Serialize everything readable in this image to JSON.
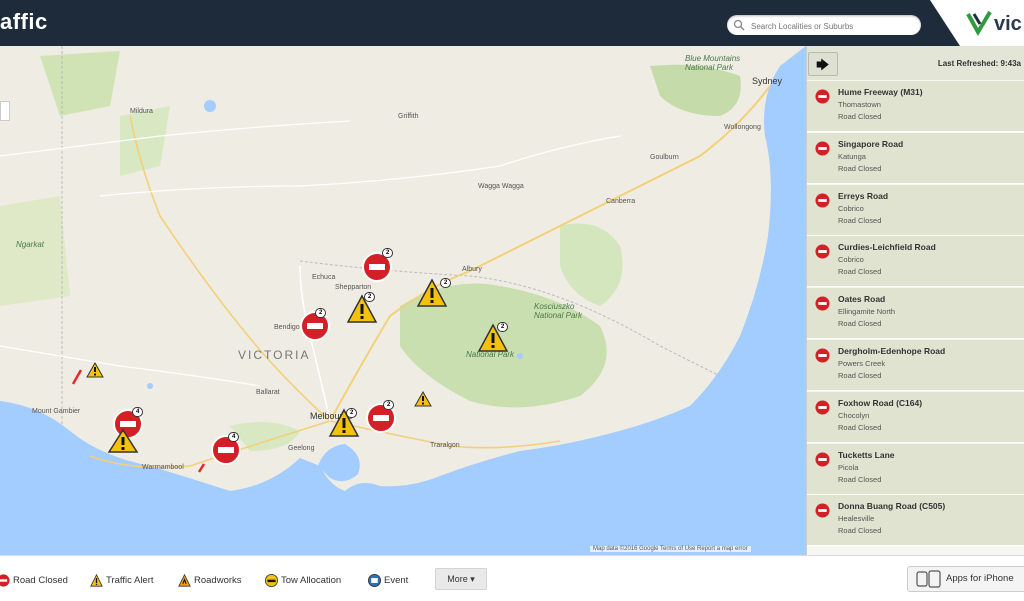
{
  "header": {
    "title": "affic",
    "search_placeholder": "Search Localities or Suburbs",
    "logo_text": "vic"
  },
  "map": {
    "region_label": "VICTORIA",
    "attribution": "Map data ©2016 Google   Terms of Use   Report a map error",
    "cities": [
      "Sydney",
      "Wollongong",
      "Canberra",
      "Goulburn",
      "Griffith",
      "Wagga Wagga",
      "Albury",
      "Echuca",
      "Shepparton",
      "Bendigo",
      "Ballarat",
      "Melbourne",
      "Geelong",
      "Traralgon",
      "Warrnambool",
      "Mount Gambier",
      "Mildura",
      "Ngarkat"
    ],
    "parks": [
      "Blue Mountains National Park",
      "Kosciuszko National Park",
      "National Park"
    ],
    "markers": [
      {
        "type": "closed",
        "count": "2"
      },
      {
        "type": "alert",
        "count": "2"
      },
      {
        "type": "closed",
        "count": "2"
      },
      {
        "type": "alert",
        "count": "2"
      },
      {
        "type": "alert",
        "count": "2"
      },
      {
        "type": "closed",
        "count": "4"
      },
      {
        "type": "closed",
        "count": "4"
      },
      {
        "type": "alert",
        "count": "2"
      },
      {
        "type": "closed",
        "count": "2"
      },
      {
        "type": "alert",
        "count": ""
      },
      {
        "type": "alert",
        "count": ""
      },
      {
        "type": "alert",
        "count": ""
      }
    ]
  },
  "panel": {
    "last_refreshed": "Last Refreshed: 9:43a",
    "back_arrow": "🡄",
    "forward_arrow": "🡆",
    "items": [
      {
        "road": "Hume Freeway (M31)",
        "place": "Thomastown",
        "status": "Road Closed"
      },
      {
        "road": "Singapore Road",
        "place": "Katunga",
        "status": "Road Closed"
      },
      {
        "road": "Erreys Road",
        "place": "Cobrico",
        "status": "Road Closed"
      },
      {
        "road": "Curdies-Leichfield Road",
        "place": "Cobrico",
        "status": "Road Closed"
      },
      {
        "road": "Oates Road",
        "place": "Ellingamite North",
        "status": "Road Closed"
      },
      {
        "road": "Dergholm-Edenhope Road",
        "place": "Powers Creek",
        "status": "Road Closed"
      },
      {
        "road": "Foxhow Road (C164)",
        "place": "Chocolyn",
        "status": "Road Closed"
      },
      {
        "road": "Tucketts Lane",
        "place": "Picola",
        "status": "Road Closed"
      },
      {
        "road": "Donna Buang Road (C505)",
        "place": "Healesville",
        "status": "Road Closed"
      }
    ]
  },
  "footer": {
    "legend": {
      "road_closed": "Road Closed",
      "traffic_alert": "Traffic Alert",
      "roadworks": "Roadworks",
      "tow_allocation": "Tow Allocation",
      "event": "Event"
    },
    "more": "More ▾",
    "apps": "Apps for iPhone"
  },
  "colors": {
    "header_bg": "#1e2b3a",
    "closed_red": "#d32027",
    "alert_yellow": "#f4c20d",
    "sea_blue": "#a3ccff",
    "panel_bg": "#dfe3d0"
  }
}
